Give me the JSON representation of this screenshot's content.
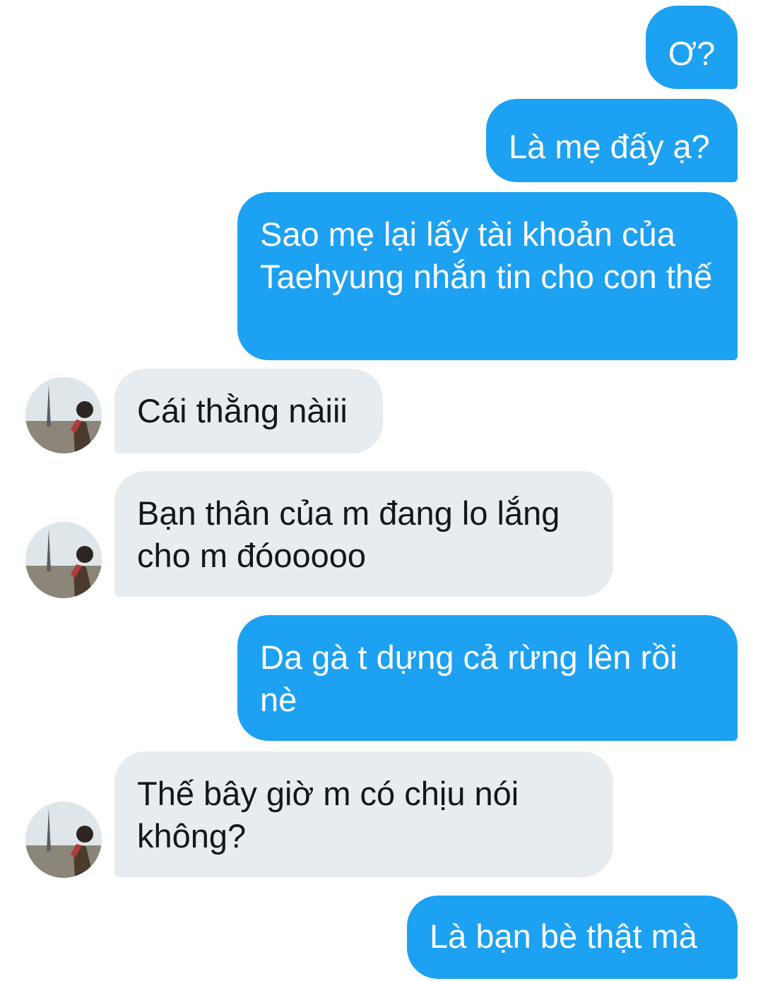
{
  "conversation": {
    "messages": [
      {
        "direction": "outgoing",
        "text": "Ơ?"
      },
      {
        "direction": "outgoing",
        "text": "Là mẹ đấy ạ?"
      },
      {
        "direction": "outgoing",
        "text": "Sao mẹ lại lấy tài khoản của Taehyung nhắn tin cho con thế"
      },
      {
        "direction": "incoming",
        "text": "Cái thằng nàiii",
        "avatar_icon": "user-avatar"
      },
      {
        "direction": "incoming",
        "text": "Bạn thân của m đang lo lắng cho m đóooooo",
        "avatar_icon": "user-avatar"
      },
      {
        "direction": "outgoing",
        "text": "Da gà t dựng cả rừng lên rồi nè"
      },
      {
        "direction": "incoming",
        "text": "Thế bây giờ m có chịu nói không?",
        "avatar_icon": "user-avatar"
      },
      {
        "direction": "outgoing",
        "text": "Là bạn bè thật mà"
      }
    ]
  },
  "colors": {
    "outgoing_bubble": "#1da1f2",
    "outgoing_text": "#ffffff",
    "incoming_bubble": "#e6ecf0",
    "incoming_text": "#14171a",
    "background": "#ffffff"
  }
}
